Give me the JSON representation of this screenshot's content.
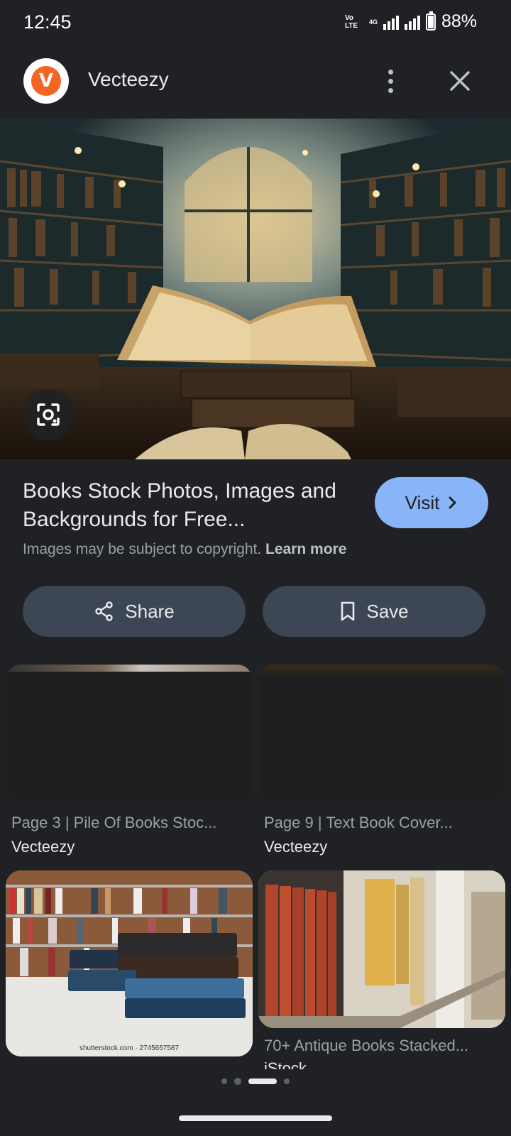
{
  "status_bar": {
    "time": "12:45",
    "volte": "Vo LTE",
    "network": "4G",
    "battery": "88%"
  },
  "header": {
    "site_name": "Vecteezy",
    "logo_letter": "V"
  },
  "result": {
    "title": "Books Stock Photos, Images and Backgrounds for Free...",
    "visit_label": "Visit",
    "copyright_text": "Images may be subject to copyright.",
    "learn_more": "Learn more"
  },
  "actions": {
    "share_label": "Share",
    "save_label": "Save"
  },
  "related": [
    {
      "title": "Page 3 | Pile Of Books Stoc...",
      "source": "Vecteezy"
    },
    {
      "title": "Page 9 | Text Book Cover...",
      "source": "Vecteezy"
    },
    {
      "title": "",
      "source": "",
      "watermark": "shutterstock.com · 2745657587"
    },
    {
      "title": "70+ Antique Books Stacked...",
      "source": "iStock"
    }
  ],
  "icons": {
    "more": "more-vert-icon",
    "close": "close-icon",
    "lens": "lens-icon",
    "share": "share-icon",
    "save": "bookmark-icon",
    "visit_arrow": "chevron-right-icon"
  },
  "colors": {
    "background": "#202124",
    "visit_button": "#8ab4f8",
    "action_button": "#3c4654",
    "logo": "#f26522"
  },
  "pager": {
    "current": 3,
    "total": 4
  }
}
